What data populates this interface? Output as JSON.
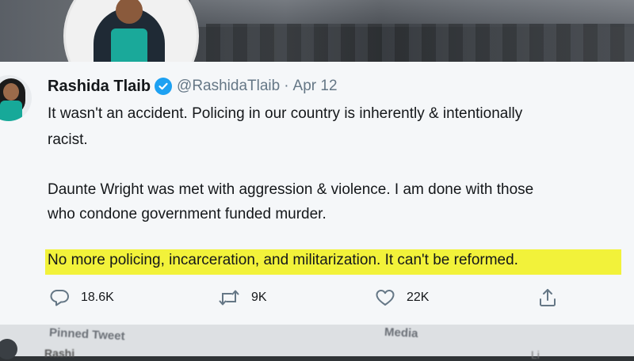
{
  "tweet": {
    "name": "Rashida Tlaib",
    "handle": "@RashidaTlaib",
    "separator": "·",
    "date": "Apr 12",
    "lines": [
      "It wasn't an accident. Policing in our country is inherently & intentionally",
      "racist.",
      "Daunte Wright was met with aggression & violence. I am done with those",
      "who condone government funded murder.",
      "No more policing, incarceration, and militarization. It can't be reformed."
    ],
    "highlight_color": "#f2f23a"
  },
  "actions": {
    "replies": "18.6K",
    "retweets": "9K",
    "likes": "22K"
  },
  "background": {
    "pinned_label": "Pinned Tweet",
    "media_tab": "Media",
    "peek_name": "Rashi",
    "peek_tab": "Li"
  },
  "colors": {
    "verified": "#1da1f2",
    "icon": "#657786",
    "text": "#14171a"
  }
}
